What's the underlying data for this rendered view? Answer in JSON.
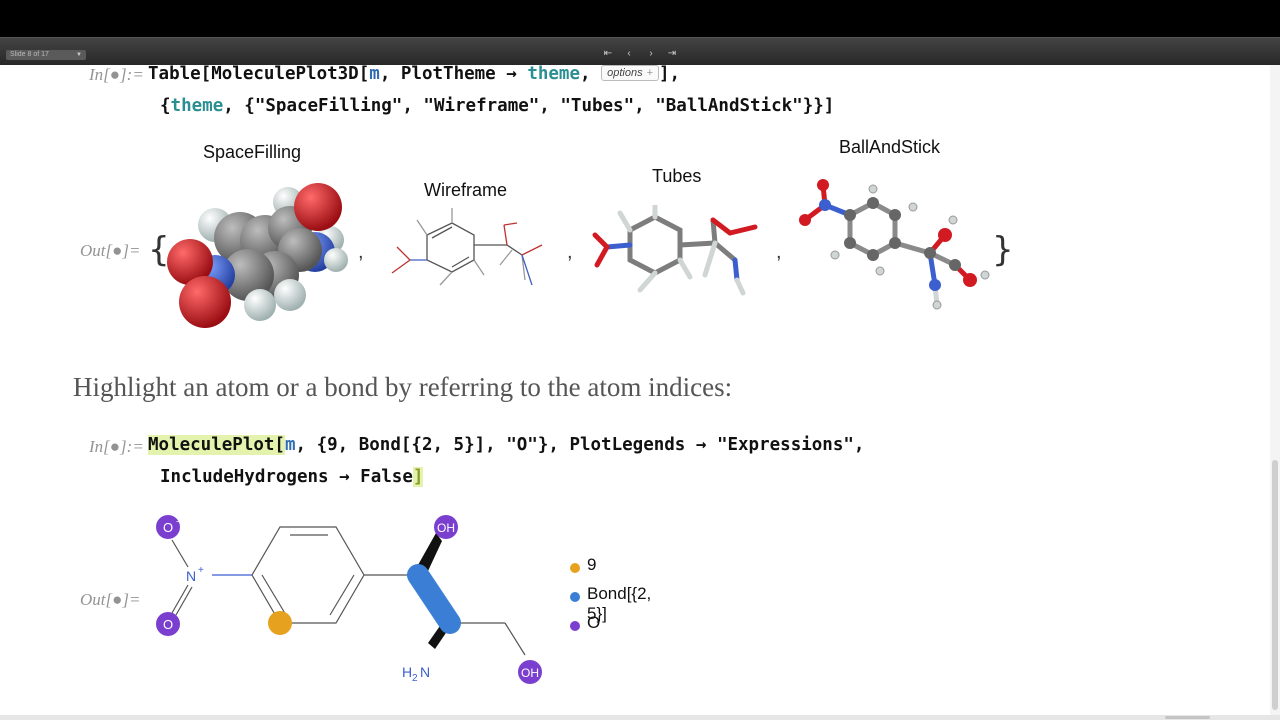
{
  "toolbar": {
    "slide_indicator": "Slide 8 of 17",
    "nav_first": "⇤",
    "nav_prev": "‹",
    "nav_next": "›",
    "nav_last": "⇥"
  },
  "cells": {
    "input1": {
      "label": "In[●]:=",
      "line1_a": "Table[MoleculePlot3D[",
      "line1_m": "m",
      "line1_b": ", PlotTheme → ",
      "line1_theme": "theme",
      "line1_c": ", ",
      "options_label": "options",
      "options_plus": "+",
      "line1_d": "],",
      "line2_a": "{",
      "line2_theme": "theme",
      "line2_b": ", {\"SpaceFilling\", \"Wireframe\", \"Tubes\", \"BallAndStick\"}}]"
    },
    "output1": {
      "label": "Out[●]=",
      "brace_open": "{",
      "brace_close": "}",
      "comma": ",",
      "molecules": [
        "SpaceFilling",
        "Wireframe",
        "Tubes",
        "BallAndStick"
      ]
    },
    "heading": "Highlight an atom or a bond by referring to the atom indices:",
    "input2": {
      "label": "In[●]:=",
      "line1_fn": "MoleculePlot[",
      "line1_m": "m",
      "line1_rest": ", {9, Bond[{2, 5}], \"O\"}, PlotLegends → \"Expressions\",",
      "line2": "IncludeHydrogens → False",
      "line2_end": "]"
    },
    "output2": {
      "label": "Out[●]=",
      "atoms": {
        "o_minus": "O",
        "o_minus_charge": "−",
        "n_plus": "N",
        "n_plus_charge": "+",
        "o_lower": "O",
        "oh_top": "OH",
        "oh_bottom": "OH",
        "amine_h": "H",
        "amine_sub": "2",
        "amine_n": "N"
      },
      "legend": [
        {
          "label": "9",
          "color": "#e6a21e"
        },
        {
          "label": "Bond[{2, 5}]",
          "color": "#3a7fd5"
        },
        {
          "label": "O",
          "color": "#7b3fd0"
        }
      ]
    }
  },
  "colors": {
    "carbon": "#7a7a7a",
    "hydrogen": "#d5dedd",
    "oxygen": "#d21a22",
    "nitrogen": "#3b5fcf",
    "highlight_atom": "#e6a21e",
    "highlight_bond": "#3a7fd5",
    "highlight_oxygen": "#7b3fd0"
  }
}
